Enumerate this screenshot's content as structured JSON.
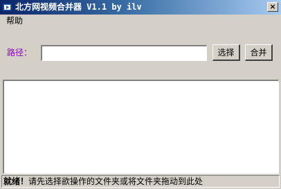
{
  "window": {
    "title": "北方网视频合并器 V1.1 by ilv",
    "close_label": "×",
    "title_color_start": "#0a246a",
    "title_color_end": "#a6caf0"
  },
  "menu": {
    "items": [
      {
        "label": "帮助"
      }
    ]
  },
  "path": {
    "label": "路径：",
    "value": "",
    "label_color": "#9000c0"
  },
  "buttons": {
    "select_label": "选择",
    "merge_label": "合并"
  },
  "file_list": {
    "items": []
  },
  "status": {
    "prefix": "就绪！",
    "message": "请先选择欲操作的文件夹或将文件夹拖动到此处"
  },
  "icons": {
    "app": "app-icon"
  }
}
